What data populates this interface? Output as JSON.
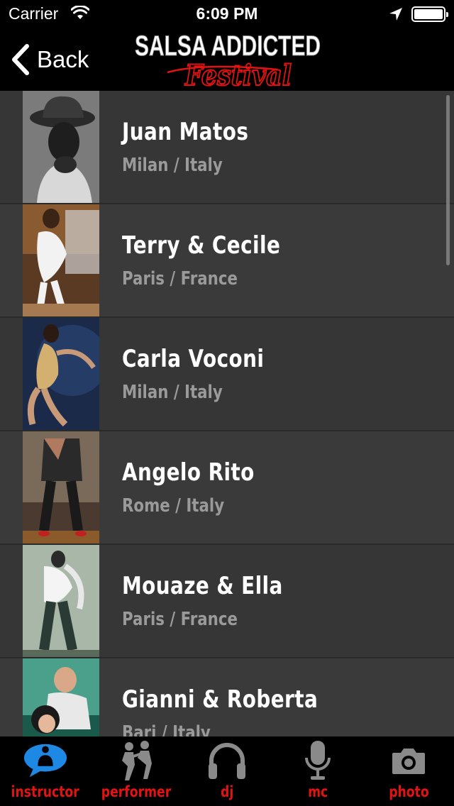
{
  "status_bar": {
    "carrier": "Carrier",
    "time": "6:09 PM"
  },
  "nav": {
    "back_label": "Back",
    "logo_line1": "SALSA ADDICTED",
    "logo_line2": "Festival"
  },
  "colors": {
    "accent": "#e31313",
    "active_tab": "#1e88e5",
    "row": "#363636",
    "row_alt": "#3a3a3a",
    "location_text": "#9a9a9a"
  },
  "list": [
    {
      "name": "Juan Matos",
      "location": "Milan / Italy",
      "photo_icon": "instructor-photo"
    },
    {
      "name": "Terry & Cecile",
      "location": "Paris / France",
      "photo_icon": "instructor-photo"
    },
    {
      "name": "Carla Voconi",
      "location": "Milan / Italy",
      "photo_icon": "instructor-photo"
    },
    {
      "name": "Angelo Rito",
      "location": "Rome / Italy",
      "photo_icon": "instructor-photo"
    },
    {
      "name": "Mouaze & Ella",
      "location": "Paris / France",
      "photo_icon": "instructor-photo"
    },
    {
      "name": "Gianni & Roberta",
      "location": "Bari / Italy",
      "photo_icon": "instructor-photo"
    }
  ],
  "tabs": [
    {
      "label": "instructor",
      "icon": "instructor-icon",
      "active": true
    },
    {
      "label": "performer",
      "icon": "performer-icon",
      "active": false
    },
    {
      "label": "dj",
      "icon": "headphones-icon",
      "active": false
    },
    {
      "label": "mc",
      "icon": "microphone-icon",
      "active": false
    },
    {
      "label": "photo",
      "icon": "camera-icon",
      "active": false
    }
  ]
}
